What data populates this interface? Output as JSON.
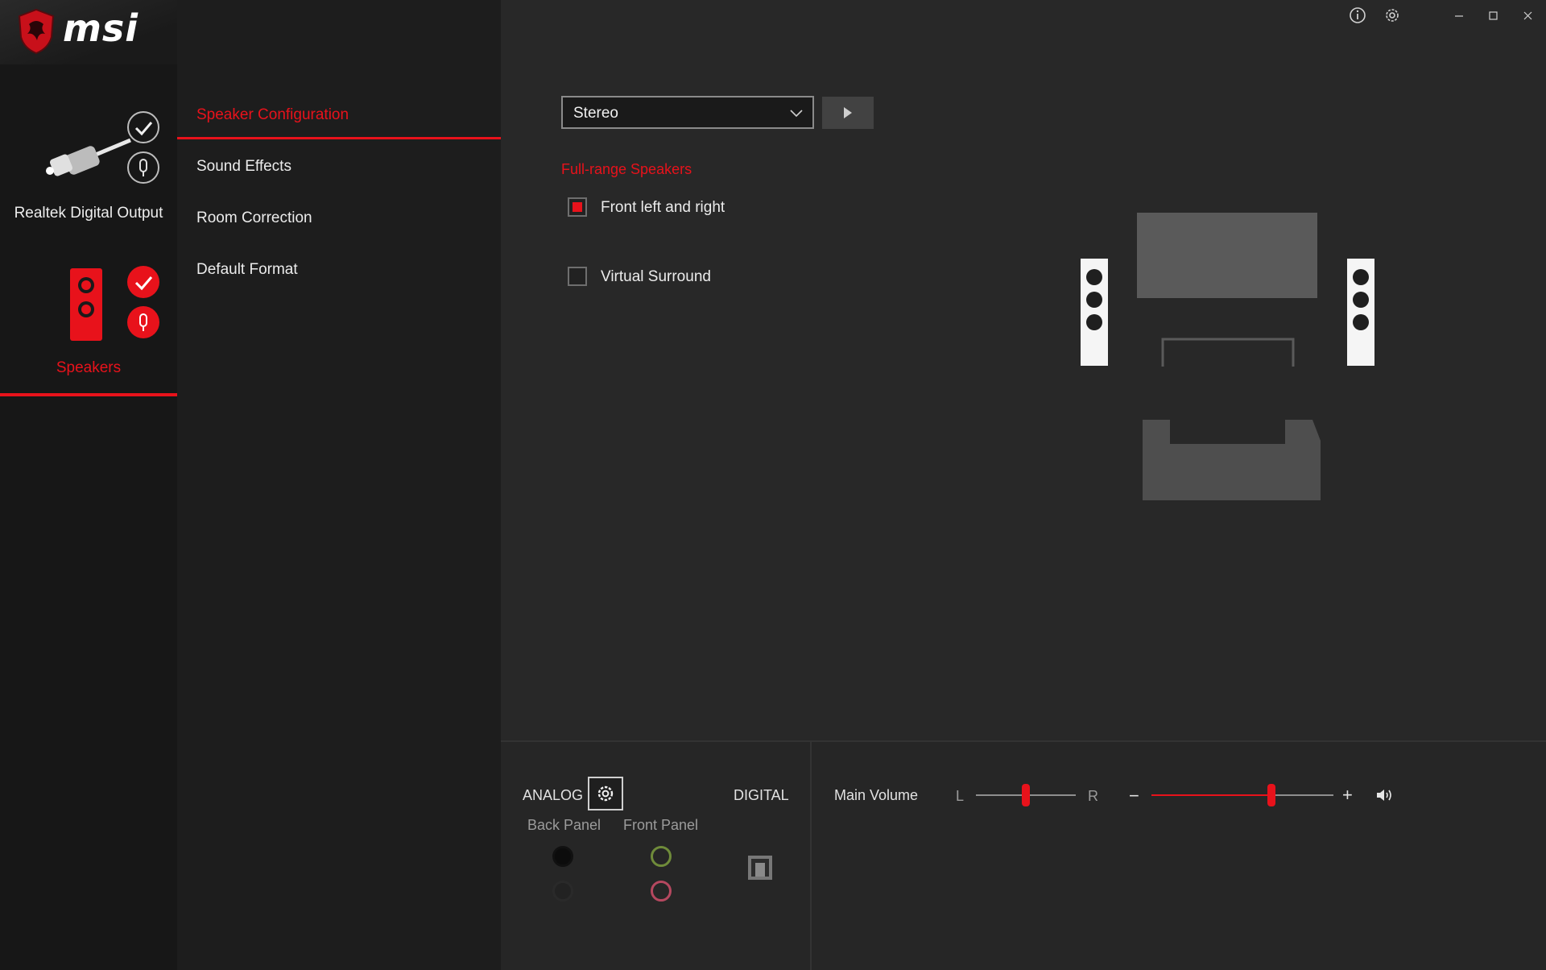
{
  "app": {
    "brand": "msi",
    "icons": {
      "info": "info-icon",
      "settings": "gear-icon",
      "minimize": "minimize-icon",
      "maximize": "maximize-icon",
      "close": "close-icon"
    }
  },
  "devices": [
    {
      "label": "Realtek Digital Output",
      "active": false,
      "icon": "digital-plug-icon"
    },
    {
      "label": "Speakers",
      "active": true,
      "icon": "speaker-icon"
    }
  ],
  "menu": [
    {
      "label": "Speaker Configuration",
      "active": true
    },
    {
      "label": "Sound Effects",
      "active": false
    },
    {
      "label": "Room Correction",
      "active": false
    },
    {
      "label": "Default Format",
      "active": false
    }
  ],
  "config": {
    "selected": "Stereo",
    "section_label": "Full-range Speakers",
    "checkboxes": [
      {
        "label": "Front left and right",
        "checked": true
      },
      {
        "label": "Virtual Surround",
        "checked": false
      }
    ]
  },
  "bottom": {
    "analog_label": "ANALOG",
    "back_panel": "Back Panel",
    "front_panel": "Front Panel",
    "digital_label": "DIGITAL",
    "main_volume": "Main Volume",
    "balance_left": "L",
    "balance_right": "R",
    "minus": "−",
    "plus": "+"
  },
  "volume": {
    "balance_fraction": 0.5,
    "level_fraction": 0.66
  },
  "colors": {
    "accent": "#e8121b",
    "jack_green": "#6f8b3a",
    "jack_pink": "#b5485f"
  }
}
